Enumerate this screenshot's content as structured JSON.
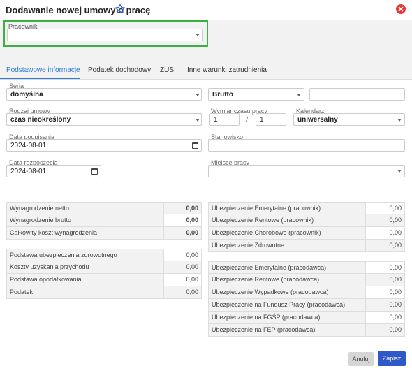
{
  "dialog": {
    "title": "Dodawanie nowej umowy o pracę"
  },
  "employee": {
    "label": "Pracownik",
    "value": ""
  },
  "tabs": [
    {
      "label": "Podstawowe informacje",
      "active": true
    },
    {
      "label": "Podatek dochodowy"
    },
    {
      "label": "ZUS"
    },
    {
      "label": "Inne warunki zatrudnienia"
    }
  ],
  "form": {
    "seria_label": "Seria",
    "seria_value": "domyślna",
    "kwota_type": "Brutto",
    "kwota_value": "",
    "rodzaj_label": "Rodzaj umowy",
    "rodzaj_value": "czas nieokreślony",
    "wymiar_label": "Wymiar czasu pracy",
    "wymiar_num": "1",
    "wymiar_sep": "/",
    "wymiar_den": "1",
    "kalendarz_label": "Kalendarz",
    "kalendarz_value": "uniwersalny",
    "data_podpisania_label": "Data podpisania",
    "data_podpisania_value": "2024-08-01",
    "stanowisko_label": "Stanowisko",
    "stanowisko_value": "",
    "data_rozpoczecia_label": "Data rozpoczęcia",
    "data_rozpoczecia_value": "2024-08-01",
    "miejsce_label": "Miejsce pracy",
    "miejsce_value": ""
  },
  "summary_left_top": [
    {
      "label": "Wynagrodzenie netto",
      "value": "0,00"
    },
    {
      "label": "Wynagrodzenie brutto",
      "value": "0,00"
    },
    {
      "label": "Całkowity koszt wynagrodzenia",
      "value": "0,00"
    }
  ],
  "summary_left_bottom": [
    {
      "label": "Podstawa ubezpieczenia zdrowotnego",
      "value": "0,00"
    },
    {
      "label": "Koszty uzyskania przychodu",
      "value": "0,00"
    },
    {
      "label": "Podstawa opodatkowania",
      "value": "0,00"
    },
    {
      "label": "Podatek",
      "value": "0,00"
    }
  ],
  "summary_right_top": [
    {
      "label": "Ubezpieczenie Emerytalne (pracownik)",
      "value": "0,00"
    },
    {
      "label": "Ubezpieczenie Rentowe (pracownik)",
      "value": "0,00"
    },
    {
      "label": "Ubezpieczenie Chorobowe (pracownik)",
      "value": "0,00"
    },
    {
      "label": "Ubezpieczenie Zdrowotne",
      "value": "0,00"
    }
  ],
  "summary_right_bottom": [
    {
      "label": "Ubezpieczenie Emerytalne (pracodawca)",
      "value": "0,00"
    },
    {
      "label": "Ubezpieczenie Rentowe (pracodawca)",
      "value": "0,00"
    },
    {
      "label": "Ubezpieczenie Wypadkowe (pracodawca)",
      "value": "0,00"
    },
    {
      "label": "Ubezpieczenie na Fundusz Pracy (pracodawca)",
      "value": "0,00"
    },
    {
      "label": "Ubezpieczenie na FGŚP (pracodawca)",
      "value": "0,00"
    },
    {
      "label": "Ubezpieczenie na FEP (pracodawca)",
      "value": "0,00"
    }
  ],
  "buttons": {
    "cancel": "Anuluj",
    "save": "Zapisz"
  },
  "colors": {
    "accent": "#2a7bd5",
    "highlight": "#3cb043",
    "danger": "#e53935",
    "primary_button": "#2f58c9"
  },
  "icons": {
    "favorite": "star-outline-icon",
    "close": "close-circle-icon",
    "calendar": "calendar-icon",
    "dropdown": "chevron-down-icon"
  }
}
